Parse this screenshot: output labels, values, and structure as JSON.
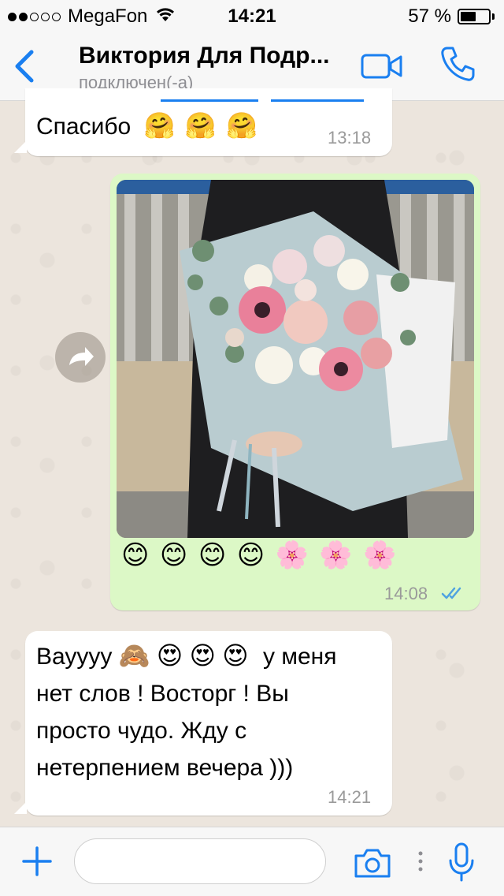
{
  "status_bar": {
    "signal_dots_filled": 2,
    "signal_dots_total": 5,
    "carrier": "MegaFon",
    "time": "14:21",
    "battery_percent_text": "57 %",
    "battery_level": 0.57
  },
  "header": {
    "contact_name": "Виктория Для Подр...",
    "contact_status": "подключен(-а)",
    "accent_color": "#1a7ff0"
  },
  "messages": [
    {
      "direction": "incoming",
      "text": "Спасибо",
      "emojis": [
        "🤗",
        "🤗",
        "🤗"
      ],
      "time": "13:18"
    },
    {
      "direction": "outgoing",
      "image": "bouquet-photo",
      "emojis": [
        "😊",
        "😊",
        "😊",
        "😊",
        "🌸",
        "🌸",
        "🌸"
      ],
      "time": "14:08",
      "read_receipt": "double-check-icon"
    },
    {
      "direction": "incoming",
      "lines": [
        {
          "text": "Вауууу",
          "emojis": [
            "🙈",
            "😍",
            "😍",
            "😍"
          ],
          "after": "у меня"
        },
        "нет слов ! Восторг ! Вы",
        "просто чудо. Жду с",
        "нетерпением вечера )))"
      ],
      "time": "14:21"
    }
  ],
  "input_bar": {
    "placeholder": ""
  },
  "colors": {
    "incoming_bubble": "#ffffff",
    "outgoing_bubble": "#dcf8c6",
    "accent": "#1a7ff0",
    "read_tick": "#4fa3e0"
  }
}
